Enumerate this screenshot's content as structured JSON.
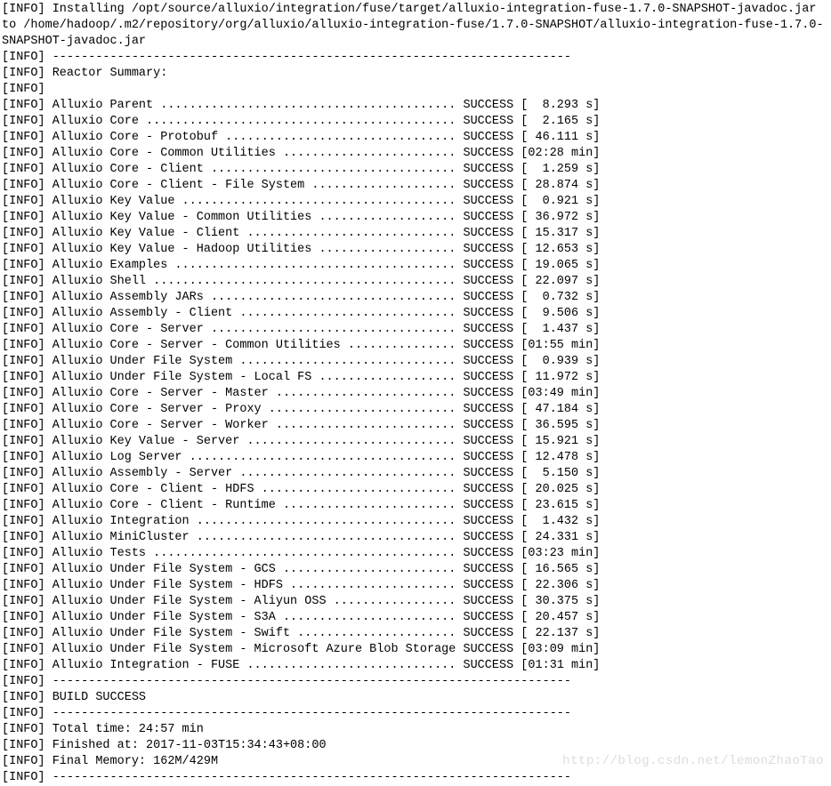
{
  "header": {
    "line1": "[INFO] Installing /opt/source/alluxio/integration/fuse/target/alluxio-integration-fuse-1.7.0-SNAPSHOT-javadoc.jar",
    "line2": "to /home/hadoop/.m2/repository/org/alluxio/alluxio-integration-fuse/1.7.0-SNAPSHOT/alluxio-integration-fuse-1.7.0-",
    "line3": "SNAPSHOT-javadoc.jar"
  },
  "separator": "[INFO] ------------------------------------------------------------------------",
  "prefix": "[INFO] ",
  "blank_info_line": "[INFO]",
  "reactor_summary_label": "Reactor Summary:",
  "status_label": "SUCCESS",
  "name_col_width": 56,
  "modules": [
    {
      "name": "Alluxio Parent",
      "time": "[  8.293 s]"
    },
    {
      "name": "Alluxio Core",
      "time": "[  2.165 s]"
    },
    {
      "name": "Alluxio Core - Protobuf",
      "time": "[ 46.111 s]"
    },
    {
      "name": "Alluxio Core - Common Utilities",
      "time": "[02:28 min]"
    },
    {
      "name": "Alluxio Core - Client",
      "time": "[  1.259 s]"
    },
    {
      "name": "Alluxio Core - Client - File System",
      "time": "[ 28.874 s]"
    },
    {
      "name": "Alluxio Key Value",
      "time": "[  0.921 s]"
    },
    {
      "name": "Alluxio Key Value - Common Utilities",
      "time": "[ 36.972 s]"
    },
    {
      "name": "Alluxio Key Value - Client",
      "time": "[ 15.317 s]"
    },
    {
      "name": "Alluxio Key Value - Hadoop Utilities",
      "time": "[ 12.653 s]"
    },
    {
      "name": "Alluxio Examples",
      "time": "[ 19.065 s]"
    },
    {
      "name": "Alluxio Shell",
      "time": "[ 22.097 s]"
    },
    {
      "name": "Alluxio Assembly JARs",
      "time": "[  0.732 s]"
    },
    {
      "name": "Alluxio Assembly - Client",
      "time": "[  9.506 s]"
    },
    {
      "name": "Alluxio Core - Server",
      "time": "[  1.437 s]"
    },
    {
      "name": "Alluxio Core - Server - Common Utilities",
      "time": "[01:55 min]"
    },
    {
      "name": "Alluxio Under File System",
      "time": "[  0.939 s]"
    },
    {
      "name": "Alluxio Under File System - Local FS",
      "time": "[ 11.972 s]"
    },
    {
      "name": "Alluxio Core - Server - Master",
      "time": "[03:49 min]"
    },
    {
      "name": "Alluxio Core - Server - Proxy",
      "time": "[ 47.184 s]"
    },
    {
      "name": "Alluxio Core - Server - Worker",
      "time": "[ 36.595 s]"
    },
    {
      "name": "Alluxio Key Value - Server",
      "time": "[ 15.921 s]"
    },
    {
      "name": "Alluxio Log Server",
      "time": "[ 12.478 s]"
    },
    {
      "name": "Alluxio Assembly - Server",
      "time": "[  5.150 s]"
    },
    {
      "name": "Alluxio Core - Client - HDFS",
      "time": "[ 20.025 s]"
    },
    {
      "name": "Alluxio Core - Client - Runtime",
      "time": "[ 23.615 s]"
    },
    {
      "name": "Alluxio Integration",
      "time": "[  1.432 s]"
    },
    {
      "name": "Alluxio MiniCluster",
      "time": "[ 24.331 s]"
    },
    {
      "name": "Alluxio Tests",
      "time": "[03:23 min]"
    },
    {
      "name": "Alluxio Under File System - GCS",
      "time": "[ 16.565 s]"
    },
    {
      "name": "Alluxio Under File System - HDFS",
      "time": "[ 22.306 s]"
    },
    {
      "name": "Alluxio Under File System - Aliyun OSS",
      "time": "[ 30.375 s]"
    },
    {
      "name": "Alluxio Under File System - S3A",
      "time": "[ 20.457 s]"
    },
    {
      "name": "Alluxio Under File System - Swift",
      "time": "[ 22.137 s]"
    },
    {
      "name": "Alluxio Under File System - Microsoft Azure Blob Storage",
      "time": "[03:09 min]"
    },
    {
      "name": "Alluxio Integration - FUSE",
      "time": "[01:31 min]"
    }
  ],
  "build_result": "BUILD SUCCESS",
  "totals": {
    "total_time": "Total time: 24:57 min",
    "finished_at": "Finished at: 2017-11-03T15:34:43+08:00",
    "final_memory": "Final Memory: 162M/429M"
  },
  "watermark": "http://blog.csdn.net/lemonZhaoTao"
}
